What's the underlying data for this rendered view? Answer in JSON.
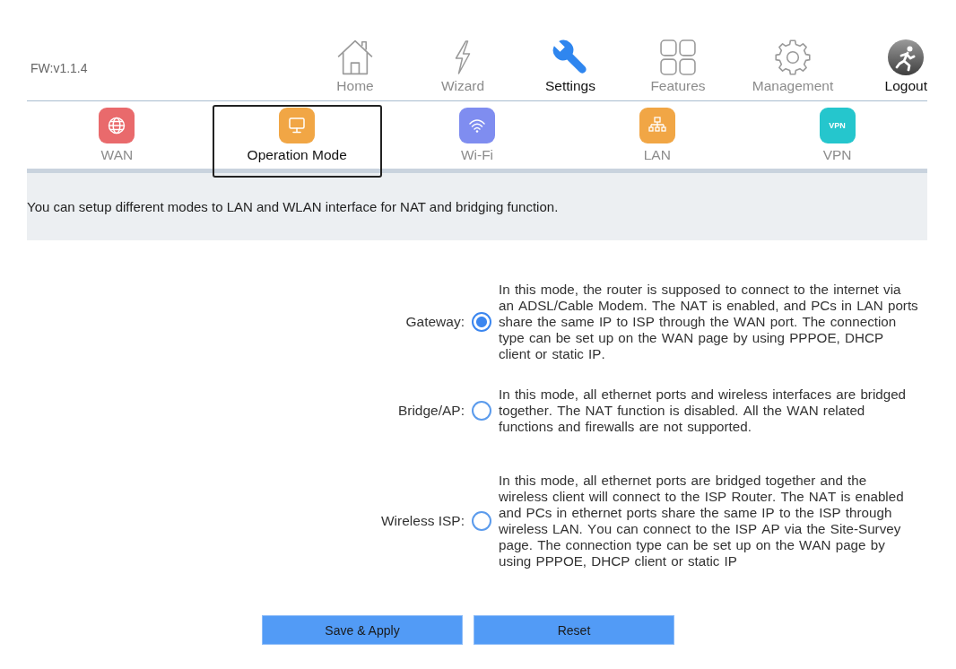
{
  "firmware": "FW:v1.1.4",
  "nav": [
    {
      "label": "Home",
      "selected": false
    },
    {
      "label": "Wizard",
      "selected": false
    },
    {
      "label": "Settings",
      "selected": true
    },
    {
      "label": "Features",
      "selected": false
    },
    {
      "label": "Management",
      "selected": false
    }
  ],
  "logout": {
    "label": "Logout"
  },
  "tabs": [
    {
      "label": "WAN",
      "selected": false,
      "color": "#e96a6c"
    },
    {
      "label": "Operation Mode",
      "selected": true,
      "color": "#f1a645"
    },
    {
      "label": "Wi-Fi",
      "selected": false,
      "color": "#7f8df0"
    },
    {
      "label": "LAN",
      "selected": false,
      "color": "#f1a645"
    },
    {
      "label": "VPN",
      "selected": false,
      "color": "#25c6cd",
      "icon_text": "VPN"
    }
  ],
  "intro": "You can setup different modes to LAN and WLAN interface for NAT and bridging function.",
  "modes": [
    {
      "label": "Gateway:",
      "selected": true,
      "description": "In this mode, the router is supposed to connect to the internet via an ADSL/Cable Modem. The NAT is enabled, and PCs in LAN ports share the same IP to ISP through the WAN port. The connection type can be set up on the WAN page by using PPPOE, DHCP client or static IP."
    },
    {
      "label": "Bridge/AP:",
      "selected": false,
      "description": "In this mode, all ethernet ports and wireless interfaces are bridged together. The NAT function is disabled. All the WAN related functions and firewalls are not supported."
    },
    {
      "label": "Wireless ISP:",
      "selected": false,
      "description": "In this mode, all ethernet ports are bridged together and the wireless client will connect to the ISP Router. The NAT is enabled and PCs in ethernet ports share the same IP to the ISP through wireless LAN. You can connect to the ISP AP via the Site-Survey page. The connection type can be set up on the WAN page by using PPPOE, DHCP client or static IP"
    }
  ],
  "buttons": [
    "Save & Apply",
    "Reset"
  ]
}
